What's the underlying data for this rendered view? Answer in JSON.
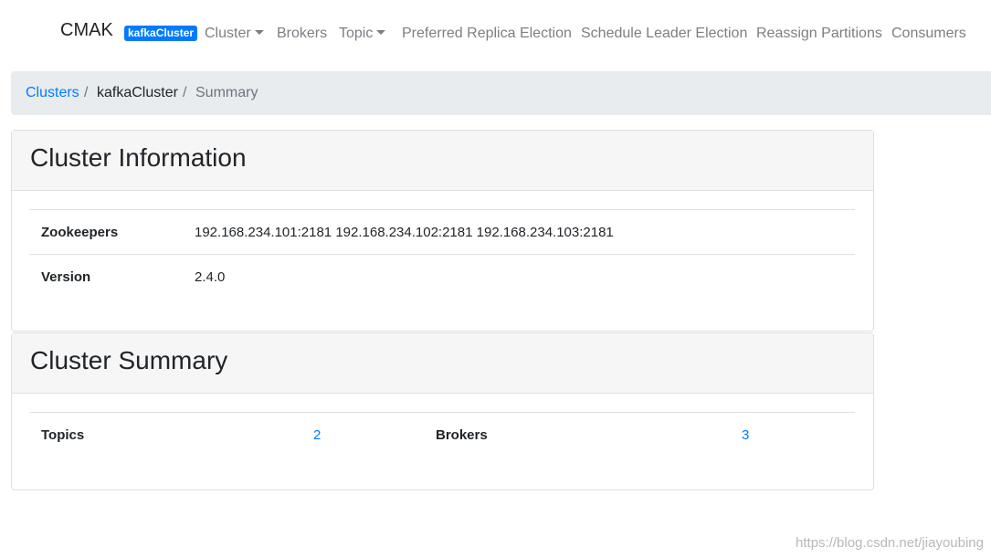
{
  "navbar": {
    "brand": "CMAK",
    "cluster_badge": "kafkaCluster",
    "items": [
      {
        "label": "Cluster"
      },
      {
        "label": "Brokers"
      },
      {
        "label": "Topic"
      },
      {
        "label": "Preferred Replica Election"
      },
      {
        "label": "Schedule Leader Election"
      },
      {
        "label": "Reassign Partitions"
      },
      {
        "label": "Consumers"
      }
    ]
  },
  "breadcrumb": {
    "items": [
      "Clusters",
      "kafkaCluster",
      "Summary"
    ],
    "separator": "/"
  },
  "cluster_information": {
    "title": "Cluster Information",
    "rows": [
      {
        "label": "Zookeepers",
        "value": "192.168.234.101:2181 192.168.234.102:2181 192.168.234.103:2181"
      },
      {
        "label": "Version",
        "value": "2.4.0"
      }
    ]
  },
  "cluster_summary": {
    "title": "Cluster Summary",
    "topics_label": "Topics",
    "topics_value": "2",
    "brokers_label": "Brokers",
    "brokers_value": "3"
  },
  "watermark": "https://blog.csdn.net/jiayoubing",
  "colors": {
    "primary": "#007bff",
    "breadcrumb_bg": "#e9ecef",
    "card_header_bg": "#f6f6f6"
  }
}
